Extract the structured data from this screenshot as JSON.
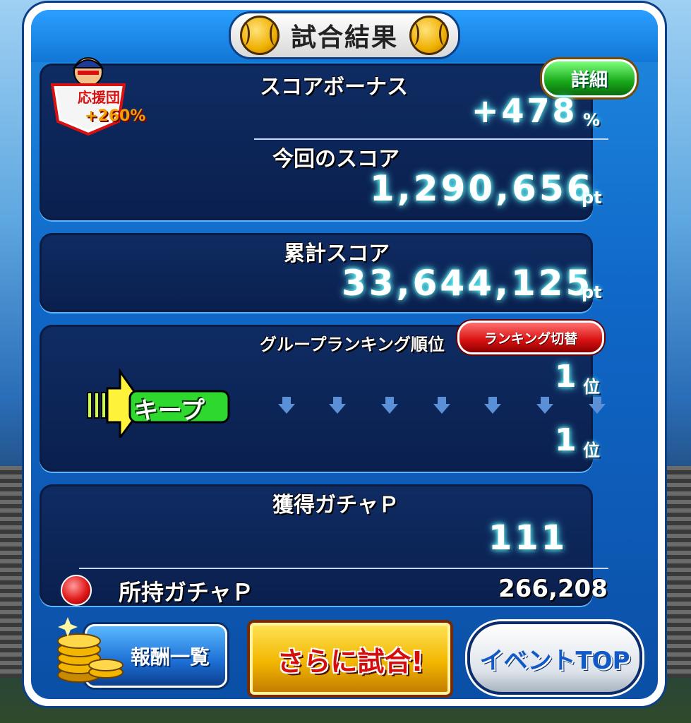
{
  "title": "試合結果",
  "cheer_badge": {
    "label": "応援団",
    "value": "+260%"
  },
  "score_bonus": {
    "label": "スコアボーナス",
    "value": "+478",
    "unit": "%"
  },
  "detail_button": "詳細",
  "current_score": {
    "label": "今回のスコア",
    "value": "1,290,656",
    "unit": "pt"
  },
  "total_score": {
    "label": "累計スコア",
    "value": "33,644,125",
    "unit": "pt"
  },
  "ranking": {
    "label": "グループランキング順位",
    "toggle_button": "ランキング切替",
    "status": "キープ",
    "before_rank": "1",
    "after_rank": "1",
    "rank_unit": "位"
  },
  "gacha": {
    "label": "獲得ガチャＰ",
    "value": "111",
    "owned_label": "所持ガチャＰ",
    "owned_value": "266,208"
  },
  "buttons": {
    "rewards": "報酬一覧",
    "play_more": "さらに試合!",
    "event_top": "イベントTOP"
  },
  "colors": {
    "panel_bg": "#0a1f4e",
    "frame_blue": "#1068c8",
    "detail_green": "#18a81a",
    "rank_red": "#d81010",
    "keep_green": "#2fd82f",
    "button_gold": "#f2b600"
  }
}
